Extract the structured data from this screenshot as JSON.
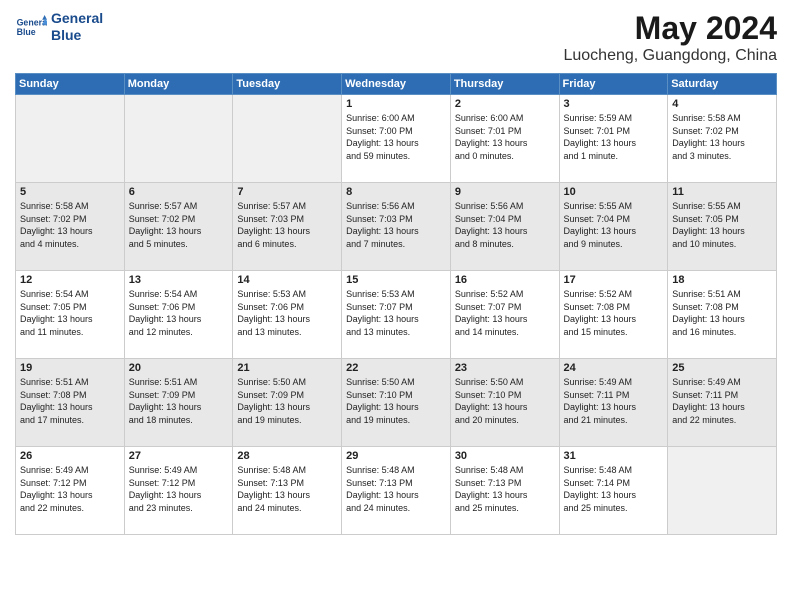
{
  "header": {
    "logo_line1": "General",
    "logo_line2": "Blue",
    "month": "May 2024",
    "location": "Luocheng, Guangdong, China"
  },
  "weekdays": [
    "Sunday",
    "Monday",
    "Tuesday",
    "Wednesday",
    "Thursday",
    "Friday",
    "Saturday"
  ],
  "weeks": [
    [
      {
        "day": "",
        "info": ""
      },
      {
        "day": "",
        "info": ""
      },
      {
        "day": "",
        "info": ""
      },
      {
        "day": "1",
        "info": "Sunrise: 6:00 AM\nSunset: 7:00 PM\nDaylight: 13 hours\nand 59 minutes."
      },
      {
        "day": "2",
        "info": "Sunrise: 6:00 AM\nSunset: 7:01 PM\nDaylight: 13 hours\nand 0 minutes."
      },
      {
        "day": "3",
        "info": "Sunrise: 5:59 AM\nSunset: 7:01 PM\nDaylight: 13 hours\nand 1 minute."
      },
      {
        "day": "4",
        "info": "Sunrise: 5:58 AM\nSunset: 7:02 PM\nDaylight: 13 hours\nand 3 minutes."
      }
    ],
    [
      {
        "day": "5",
        "info": "Sunrise: 5:58 AM\nSunset: 7:02 PM\nDaylight: 13 hours\nand 4 minutes."
      },
      {
        "day": "6",
        "info": "Sunrise: 5:57 AM\nSunset: 7:02 PM\nDaylight: 13 hours\nand 5 minutes."
      },
      {
        "day": "7",
        "info": "Sunrise: 5:57 AM\nSunset: 7:03 PM\nDaylight: 13 hours\nand 6 minutes."
      },
      {
        "day": "8",
        "info": "Sunrise: 5:56 AM\nSunset: 7:03 PM\nDaylight: 13 hours\nand 7 minutes."
      },
      {
        "day": "9",
        "info": "Sunrise: 5:56 AM\nSunset: 7:04 PM\nDaylight: 13 hours\nand 8 minutes."
      },
      {
        "day": "10",
        "info": "Sunrise: 5:55 AM\nSunset: 7:04 PM\nDaylight: 13 hours\nand 9 minutes."
      },
      {
        "day": "11",
        "info": "Sunrise: 5:55 AM\nSunset: 7:05 PM\nDaylight: 13 hours\nand 10 minutes."
      }
    ],
    [
      {
        "day": "12",
        "info": "Sunrise: 5:54 AM\nSunset: 7:05 PM\nDaylight: 13 hours\nand 11 minutes."
      },
      {
        "day": "13",
        "info": "Sunrise: 5:54 AM\nSunset: 7:06 PM\nDaylight: 13 hours\nand 12 minutes."
      },
      {
        "day": "14",
        "info": "Sunrise: 5:53 AM\nSunset: 7:06 PM\nDaylight: 13 hours\nand 13 minutes."
      },
      {
        "day": "15",
        "info": "Sunrise: 5:53 AM\nSunset: 7:07 PM\nDaylight: 13 hours\nand 13 minutes."
      },
      {
        "day": "16",
        "info": "Sunrise: 5:52 AM\nSunset: 7:07 PM\nDaylight: 13 hours\nand 14 minutes."
      },
      {
        "day": "17",
        "info": "Sunrise: 5:52 AM\nSunset: 7:08 PM\nDaylight: 13 hours\nand 15 minutes."
      },
      {
        "day": "18",
        "info": "Sunrise: 5:51 AM\nSunset: 7:08 PM\nDaylight: 13 hours\nand 16 minutes."
      }
    ],
    [
      {
        "day": "19",
        "info": "Sunrise: 5:51 AM\nSunset: 7:08 PM\nDaylight: 13 hours\nand 17 minutes."
      },
      {
        "day": "20",
        "info": "Sunrise: 5:51 AM\nSunset: 7:09 PM\nDaylight: 13 hours\nand 18 minutes."
      },
      {
        "day": "21",
        "info": "Sunrise: 5:50 AM\nSunset: 7:09 PM\nDaylight: 13 hours\nand 19 minutes."
      },
      {
        "day": "22",
        "info": "Sunrise: 5:50 AM\nSunset: 7:10 PM\nDaylight: 13 hours\nand 19 minutes."
      },
      {
        "day": "23",
        "info": "Sunrise: 5:50 AM\nSunset: 7:10 PM\nDaylight: 13 hours\nand 20 minutes."
      },
      {
        "day": "24",
        "info": "Sunrise: 5:49 AM\nSunset: 7:11 PM\nDaylight: 13 hours\nand 21 minutes."
      },
      {
        "day": "25",
        "info": "Sunrise: 5:49 AM\nSunset: 7:11 PM\nDaylight: 13 hours\nand 22 minutes."
      }
    ],
    [
      {
        "day": "26",
        "info": "Sunrise: 5:49 AM\nSunset: 7:12 PM\nDaylight: 13 hours\nand 22 minutes."
      },
      {
        "day": "27",
        "info": "Sunrise: 5:49 AM\nSunset: 7:12 PM\nDaylight: 13 hours\nand 23 minutes."
      },
      {
        "day": "28",
        "info": "Sunrise: 5:48 AM\nSunset: 7:13 PM\nDaylight: 13 hours\nand 24 minutes."
      },
      {
        "day": "29",
        "info": "Sunrise: 5:48 AM\nSunset: 7:13 PM\nDaylight: 13 hours\nand 24 minutes."
      },
      {
        "day": "30",
        "info": "Sunrise: 5:48 AM\nSunset: 7:13 PM\nDaylight: 13 hours\nand 25 minutes."
      },
      {
        "day": "31",
        "info": "Sunrise: 5:48 AM\nSunset: 7:14 PM\nDaylight: 13 hours\nand 25 minutes."
      },
      {
        "day": "",
        "info": ""
      }
    ]
  ]
}
